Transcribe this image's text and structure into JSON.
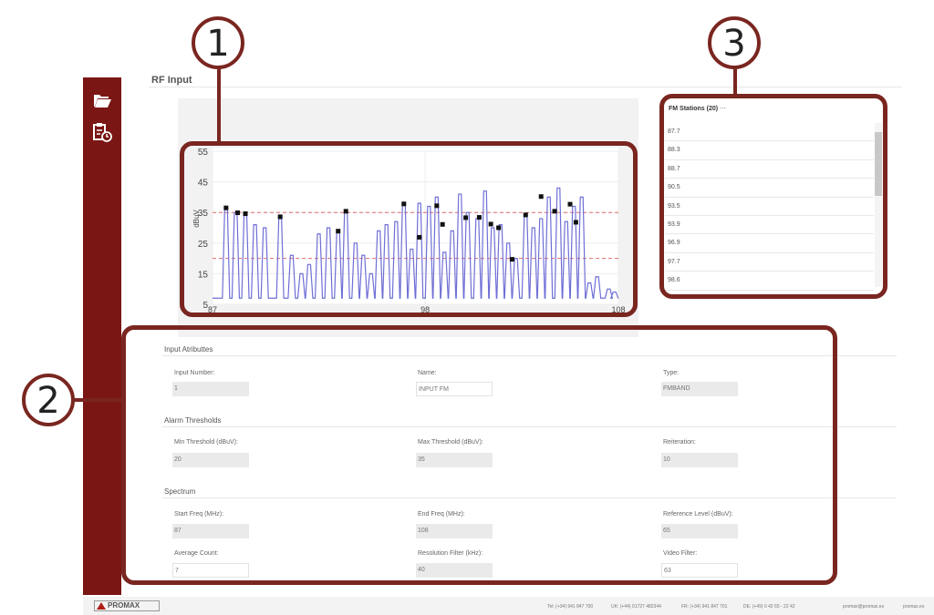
{
  "header": {
    "title": "RF Input"
  },
  "sidebar": {
    "icons": [
      "folder-open-icon",
      "clipboard-clock-icon"
    ]
  },
  "chart_data": {
    "type": "line",
    "y_unit_label": "dBuV",
    "x_ticks": [
      "87",
      "98",
      "108"
    ],
    "y_ticks": [
      "5",
      "15",
      "25",
      "35",
      "45",
      "55"
    ],
    "xlim": [
      87,
      108
    ],
    "ylim": [
      5,
      55
    ],
    "max_threshold": 35,
    "min_threshold": 20,
    "series": [
      {
        "x": [
          87.7,
          88.2,
          88.7,
          89.2,
          89.7,
          90.5,
          91.1,
          91.6,
          92.0,
          92.5,
          93.0,
          93.5,
          93.9,
          94.4,
          94.8,
          95.2,
          95.6,
          96.0,
          96.5,
          96.9,
          97.3,
          97.7,
          98.2,
          98.6,
          99.0,
          99.4,
          99.8,
          100.2,
          100.7,
          101.1,
          101.5,
          101.9,
          102.3,
          102.7,
          103.2,
          103.6,
          104.0,
          104.4,
          104.9,
          105.3,
          105.7,
          106.1,
          106.5,
          106.9,
          107.5,
          107.8
        ],
        "y": [
          36,
          35,
          34,
          31,
          30,
          33,
          21,
          15,
          18,
          28,
          30,
          29,
          35,
          25,
          21,
          15,
          29,
          31,
          32,
          38,
          23,
          38,
          37,
          40,
          22,
          29,
          41,
          35,
          33,
          42,
          30,
          31,
          25,
          20,
          34,
          30,
          33,
          40,
          43,
          32,
          37,
          40,
          12,
          14,
          10,
          9
        ]
      }
    ],
    "markers": [
      {
        "x": 87.7,
        "y": 36.5
      },
      {
        "x": 88.3,
        "y": 34.9
      },
      {
        "x": 88.7,
        "y": 34.6
      },
      {
        "x": 90.5,
        "y": 33.6
      },
      {
        "x": 93.5,
        "y": 28.9
      },
      {
        "x": 93.9,
        "y": 35.4
      },
      {
        "x": 96.9,
        "y": 37.8
      },
      {
        "x": 97.7,
        "y": 26.9
      },
      {
        "x": 98.6,
        "y": 37.2
      },
      {
        "x": 98.9,
        "y": 31.1
      },
      {
        "x": 100.1,
        "y": 33.3
      },
      {
        "x": 100.8,
        "y": 33.4
      },
      {
        "x": 101.4,
        "y": 31.2
      },
      {
        "x": 101.8,
        "y": 30.0
      },
      {
        "x": 102.5,
        "y": 19.7
      },
      {
        "x": 103.2,
        "y": 34.2
      },
      {
        "x": 104.0,
        "y": 40.2
      },
      {
        "x": 104.7,
        "y": 35.4
      },
      {
        "x": 105.5,
        "y": 37.7
      },
      {
        "x": 105.8,
        "y": 31.8
      }
    ]
  },
  "colors": {
    "sidebar": "#7a1614",
    "callout": "#7a2620",
    "line": "#6f6fd6",
    "threshold": "#e06d6d"
  },
  "callouts": {
    "one": "1",
    "two": "2",
    "three": "3"
  },
  "stations": {
    "title": "FM Stations (20)",
    "title_suffix": "···",
    "items": [
      "87.7",
      "88.3",
      "88.7",
      "90.5",
      "93.5",
      "93.9",
      "96.9",
      "97.7",
      "98.6"
    ]
  },
  "form": {
    "input_attributes": {
      "title": "Input Atributtes",
      "input_number": {
        "label": "Input Number:",
        "value": "1"
      },
      "name": {
        "label": "Name:",
        "value": "INPUT FM"
      },
      "type": {
        "label": "Type:",
        "value": "FMBAND"
      }
    },
    "alarm_thresholds": {
      "title": "Alarm Thresholds",
      "min": {
        "label": "Min Threshold (dBuV):",
        "value": "20"
      },
      "max": {
        "label": "Max Threshold (dBuV):",
        "value": "35"
      },
      "reiteration": {
        "label": "Reiteration:",
        "value": "10"
      }
    },
    "spectrum": {
      "title": "Spectrum",
      "start_freq": {
        "label": "Start Freq (MHz):",
        "value": "87"
      },
      "end_freq": {
        "label": "End Freq (MHz):",
        "value": "108"
      },
      "reference_level": {
        "label": "Reference Level (dBuV):",
        "value": "65"
      },
      "average_count": {
        "label": "Average Count:",
        "value": "7"
      },
      "resolution_filter": {
        "label": "Resolution Filter (kHz):",
        "value": "40"
      },
      "video_filter": {
        "label": "Video Filter:",
        "value": "63"
      }
    }
  },
  "footer": {
    "logo": "PROMAX",
    "tel_es": "Tel: (+34) 941 847 700",
    "tel_uk": "UK: (+44) 01727 482344",
    "tel_fr": "FR: (+34) 941 847 701",
    "tel_de": "DE: (+49) 0 42 65 - 22 42",
    "email": "promax@promax.es",
    "web": "promax.es"
  }
}
